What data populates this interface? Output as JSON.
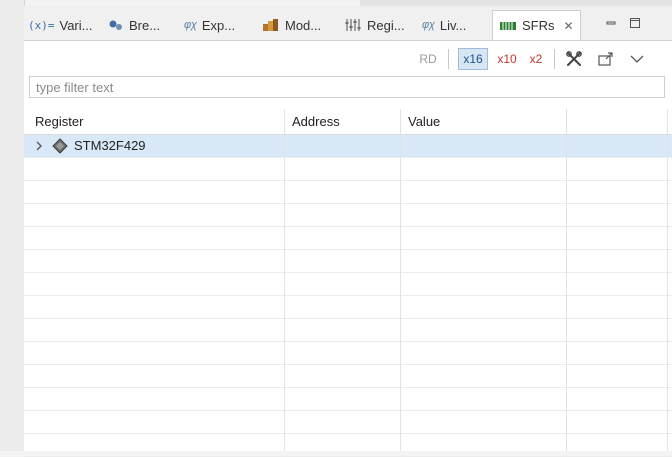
{
  "tabs": [
    {
      "label": "Vari...",
      "icon": "variables-icon"
    },
    {
      "label": "Bre...",
      "icon": "breakpoints-icon"
    },
    {
      "label": "Exp...",
      "icon": "expressions-icon"
    },
    {
      "label": "Mod...",
      "icon": "modules-icon"
    },
    {
      "label": "Regi...",
      "icon": "registers-icon"
    },
    {
      "label": "Liv...",
      "icon": "live-expressions-icon"
    },
    {
      "label": "SFRs",
      "icon": "sfrs-icon",
      "active": true
    }
  ],
  "toolbar": {
    "rd_label": "RD",
    "hex_label": "x16",
    "dec_label": "x10",
    "bin_label": "x2"
  },
  "filter": {
    "placeholder": "type filter text",
    "value": ""
  },
  "table": {
    "columns": [
      "Register",
      "Address",
      "Value",
      ""
    ],
    "rows": [
      {
        "register": "STM32F429",
        "address": "",
        "value": "",
        "expandable": true,
        "selected": true
      }
    ]
  },
  "colors": {
    "selection": "#d9e8f7",
    "hex_active": "#d7e6f5",
    "accent_red": "#c0392b"
  }
}
